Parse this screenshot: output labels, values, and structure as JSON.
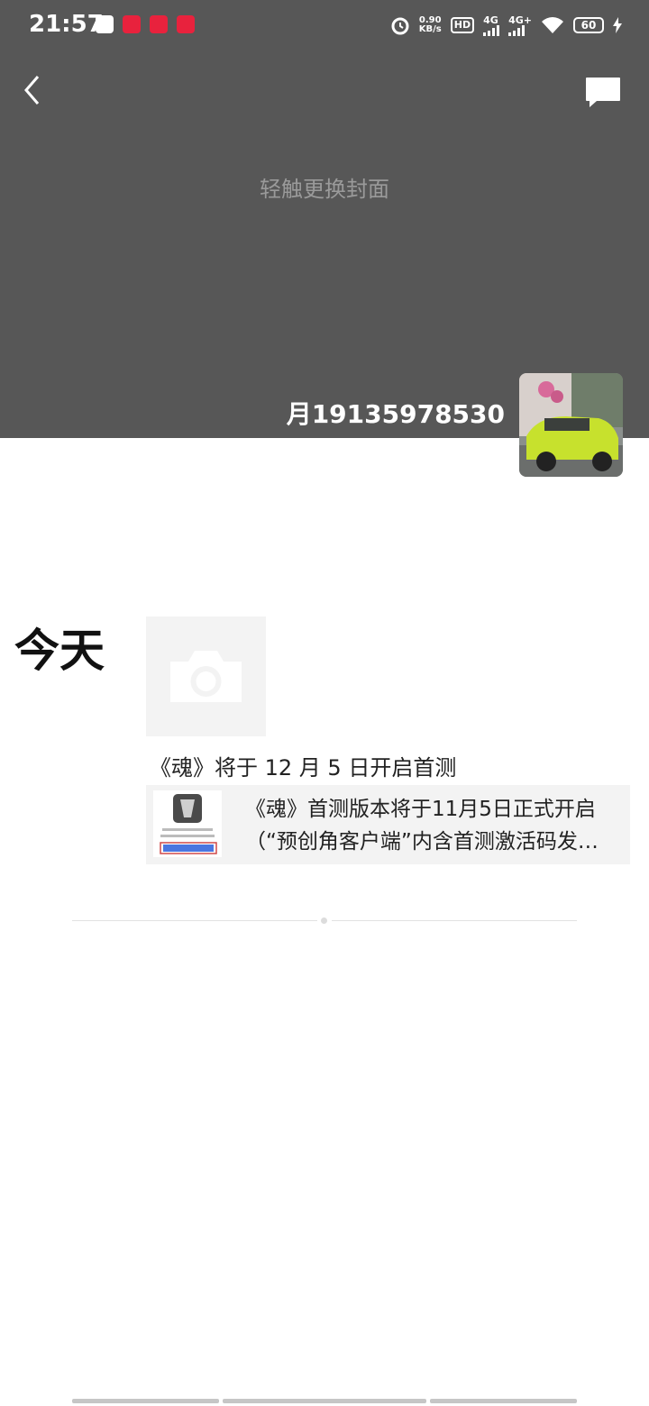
{
  "status_bar": {
    "time": "21:57",
    "net_speed_value": "0.90",
    "net_speed_unit": "KB/s",
    "hd_label": "HD",
    "sim1_label": "4G",
    "sim2_label": "4G+",
    "battery_level": "60"
  },
  "header": {
    "back_icon": "chevron-left-icon",
    "message_icon": "message-bubble-icon"
  },
  "cover": {
    "hint": "轻触更换封面"
  },
  "profile": {
    "nickname": "月19135978530"
  },
  "feed": {
    "day_label": "今天",
    "post_text": "《魂》将于 12 月 5 日开启首测",
    "share": {
      "title_line1": "《魂》首测版本将于11月5日正式开启",
      "title_line2": "（“预创角客户端”内含首测激活码发…"
    }
  },
  "colors": {
    "cover_bg": "#575757",
    "card_bg": "#f3f3f3"
  }
}
